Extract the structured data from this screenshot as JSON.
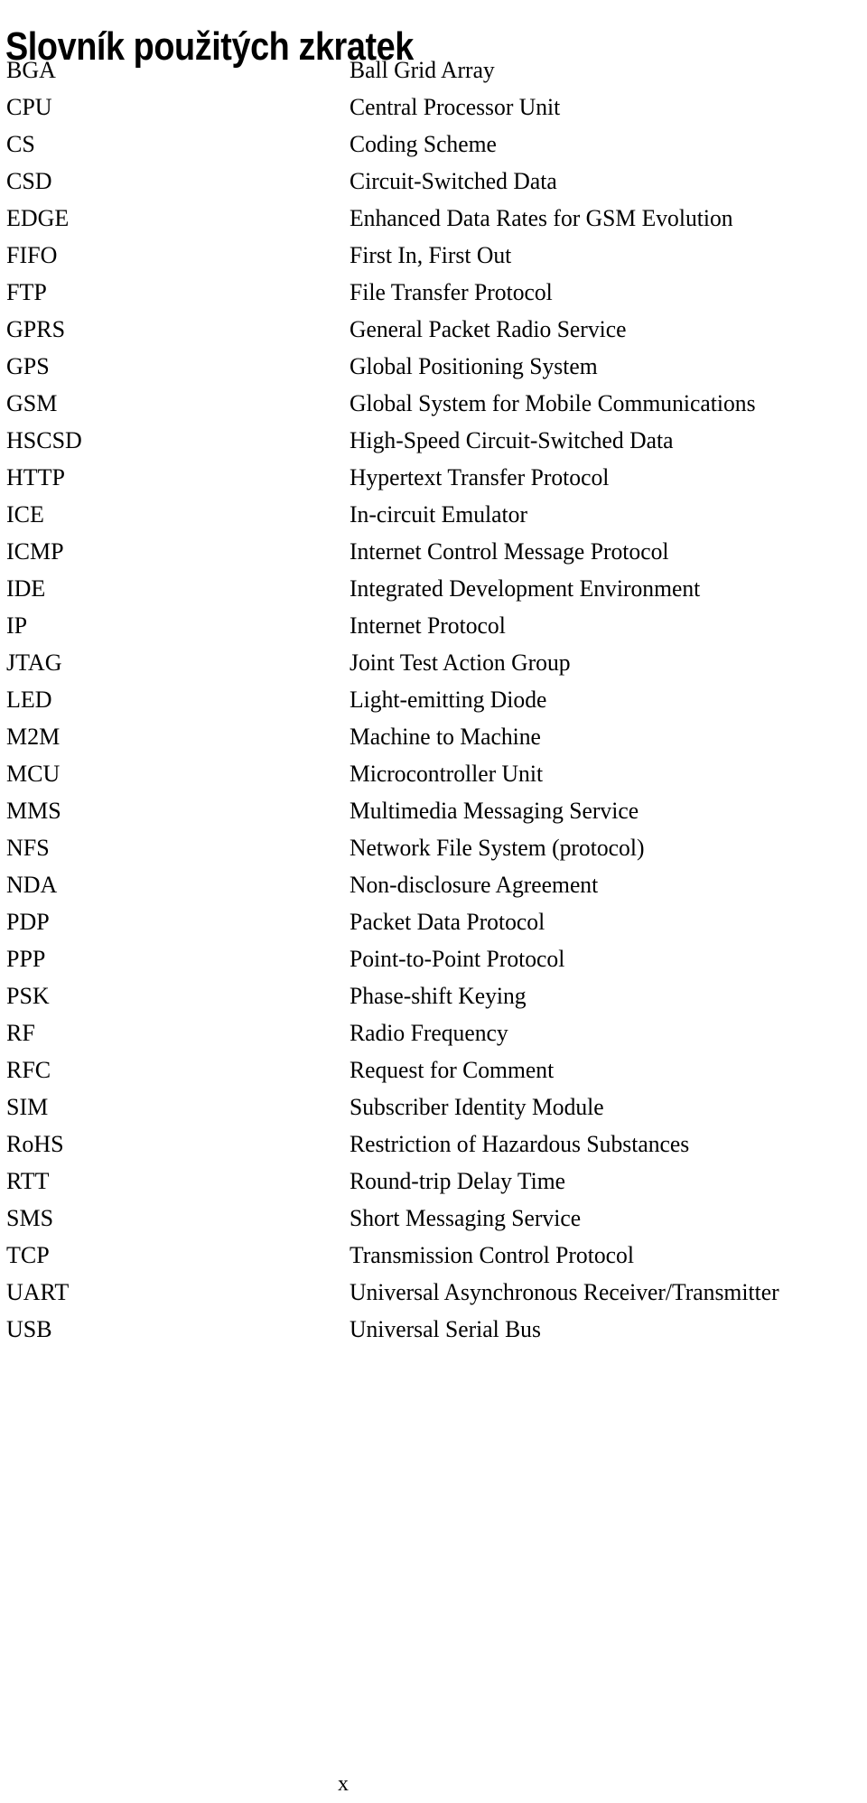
{
  "document": {
    "title": "Slovník použitých zkratek",
    "page_number": "x"
  },
  "glossary": {
    "entries": [
      {
        "term": "BGA",
        "definition": "Ball Grid Array"
      },
      {
        "term": "CPU",
        "definition": "Central Processor Unit"
      },
      {
        "term": "CS",
        "definition": "Coding Scheme"
      },
      {
        "term": "CSD",
        "definition": "Circuit-Switched Data"
      },
      {
        "term": "EDGE",
        "definition": "Enhanced Data Rates for GSM Evolution"
      },
      {
        "term": "FIFO",
        "definition": "First In, First Out"
      },
      {
        "term": "FTP",
        "definition": "File Transfer Protocol"
      },
      {
        "term": "GPRS",
        "definition": "General Packet Radio Service"
      },
      {
        "term": "GPS",
        "definition": "Global Positioning System"
      },
      {
        "term": "GSM",
        "definition": "Global System for Mobile Communications"
      },
      {
        "term": "HSCSD",
        "definition": "High-Speed Circuit-Switched Data"
      },
      {
        "term": "HTTP",
        "definition": "Hypertext Transfer Protocol"
      },
      {
        "term": "ICE",
        "definition": "In-circuit Emulator"
      },
      {
        "term": "ICMP",
        "definition": "Internet Control Message Protocol"
      },
      {
        "term": "IDE",
        "definition": "Integrated Development Environment"
      },
      {
        "term": "IP",
        "definition": "Internet Protocol"
      },
      {
        "term": "JTAG",
        "definition": "Joint Test Action Group"
      },
      {
        "term": "LED",
        "definition": "Light-emitting Diode"
      },
      {
        "term": "M2M",
        "definition": "Machine to Machine"
      },
      {
        "term": "MCU",
        "definition": "Microcontroller Unit"
      },
      {
        "term": "MMS",
        "definition": "Multimedia Messaging Service"
      },
      {
        "term": "NFS",
        "definition": "Network File System (protocol)"
      },
      {
        "term": "NDA",
        "definition": "Non-disclosure Agreement"
      },
      {
        "term": "PDP",
        "definition": "Packet Data Protocol"
      },
      {
        "term": "PPP",
        "definition": "Point-to-Point Protocol"
      },
      {
        "term": "PSK",
        "definition": "Phase-shift Keying"
      },
      {
        "term": "RF",
        "definition": "Radio Frequency"
      },
      {
        "term": "RFC",
        "definition": "Request for Comment"
      },
      {
        "term": "SIM",
        "definition": "Subscriber Identity Module"
      },
      {
        "term": "RoHS",
        "definition": "Restriction of Hazardous Substances"
      },
      {
        "term": "RTT",
        "definition": "Round-trip Delay Time"
      },
      {
        "term": "SMS",
        "definition": "Short Messaging Service"
      },
      {
        "term": "TCP",
        "definition": "Transmission Control Protocol"
      },
      {
        "term": "UART",
        "definition": "Universal Asynchronous Receiver/Transmitter"
      },
      {
        "term": "USB",
        "definition": "Universal Serial Bus"
      }
    ]
  }
}
